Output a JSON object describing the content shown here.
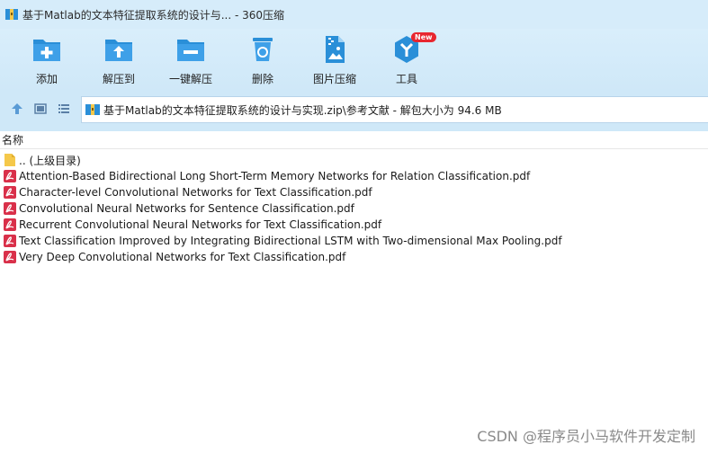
{
  "window": {
    "title": "基于Matlab的文本特征提取系统的设计与... - 360压缩"
  },
  "toolbar": {
    "items": [
      {
        "label": "添加",
        "icon": "add-folder-icon"
      },
      {
        "label": "解压到",
        "icon": "extract-folder-icon"
      },
      {
        "label": "一键解压",
        "icon": "one-click-extract-icon"
      },
      {
        "label": "删除",
        "icon": "recycle-bin-icon"
      },
      {
        "label": "图片压缩",
        "icon": "image-compress-icon"
      },
      {
        "label": "工具",
        "icon": "tools-icon",
        "badge": "New"
      }
    ]
  },
  "address": {
    "path": "基于Matlab的文本特征提取系统的设计与实现.zip\\参考文献 - 解包大小为 94.6 MB"
  },
  "list": {
    "column_name": "名称",
    "parent": ".. (上级目录)",
    "files": [
      "Attention-Based Bidirectional Long Short-Term Memory Networks for Relation Classification.pdf",
      "Character-level Convolutional Networks for Text Classification.pdf",
      "Convolutional Neural Networks for Sentence Classification.pdf",
      "Recurrent Convolutional Neural Networks for Text Classification.pdf",
      "Text Classification Improved by Integrating Bidirectional LSTM with Two-dimensional Max Pooling.pdf",
      "Very Deep Convolutional Networks for Text Classification.pdf"
    ]
  },
  "watermark": "CSDN @程序员小马软件开发定制",
  "colors": {
    "accent": "#2a8fd8",
    "titlebar": "#d6ecfa",
    "toolbar": "#cfe8f8",
    "pdf": "#d9304a",
    "folder": "#f5c84a"
  }
}
